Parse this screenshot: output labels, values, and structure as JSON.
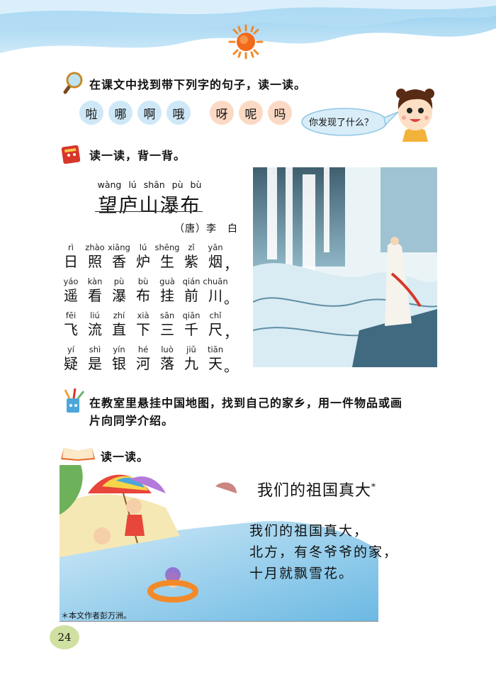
{
  "section1": {
    "instruction": "在课文中找到带下列字的句子，读一读。",
    "chars_blue": [
      "啦",
      "哪",
      "啊",
      "哦"
    ],
    "chars_orange": [
      "呀",
      "呢",
      "吗"
    ],
    "speech_bubble": "你发现了什么？"
  },
  "section2": {
    "instruction": "读一读，背一背。",
    "poem": {
      "title_pinyin": "wàng lú shān pù bù",
      "title": "望庐山瀑布",
      "author": "（唐）李　白",
      "lines": [
        {
          "pinyin": [
            "rì",
            "zhào",
            "xiāng",
            "lú",
            "shēng",
            "zǐ",
            "yān"
          ],
          "chars": [
            "日",
            "照",
            "香",
            "炉",
            "生",
            "紫",
            "烟"
          ],
          "punct": "，"
        },
        {
          "pinyin": [
            "yáo",
            "kàn",
            "pù",
            "bù",
            "guà",
            "qián",
            "chuān"
          ],
          "chars": [
            "遥",
            "看",
            "瀑",
            "布",
            "挂",
            "前",
            "川"
          ],
          "punct": "。"
        },
        {
          "pinyin": [
            "fēi",
            "liú",
            "zhí",
            "xià",
            "sān",
            "qiān",
            "chǐ"
          ],
          "chars": [
            "飞",
            "流",
            "直",
            "下",
            "三",
            "千",
            "尺"
          ],
          "punct": "，"
        },
        {
          "pinyin": [
            "yí",
            "shì",
            "yín",
            "hé",
            "luò",
            "jiǔ",
            "tiān"
          ],
          "chars": [
            "疑",
            "是",
            "银",
            "河",
            "落",
            "九",
            "天"
          ],
          "punct": "。"
        }
      ]
    }
  },
  "section3": {
    "instruction_line1": "在教室里悬挂中国地图，找到自己的家乡，用一件物品或画",
    "instruction_line2": "片向同学介绍。"
  },
  "section4": {
    "instruction": "读一读。",
    "song_title": "我们的祖国真大",
    "song_title_mark": "*",
    "lines": [
      "我们的祖国真大，",
      "北方，有冬爷爷的家，",
      "十月就飘雪花。"
    ],
    "footnote": "＊本文作者彭万洲。"
  },
  "page_number": "24",
  "colors": {
    "sky_blue": "#a9d6f0",
    "pill_blue": "#cfe8f7",
    "pill_orange": "#fbd9c4",
    "sun": "#f08a2a",
    "page_badge": "#cfe0a0"
  }
}
